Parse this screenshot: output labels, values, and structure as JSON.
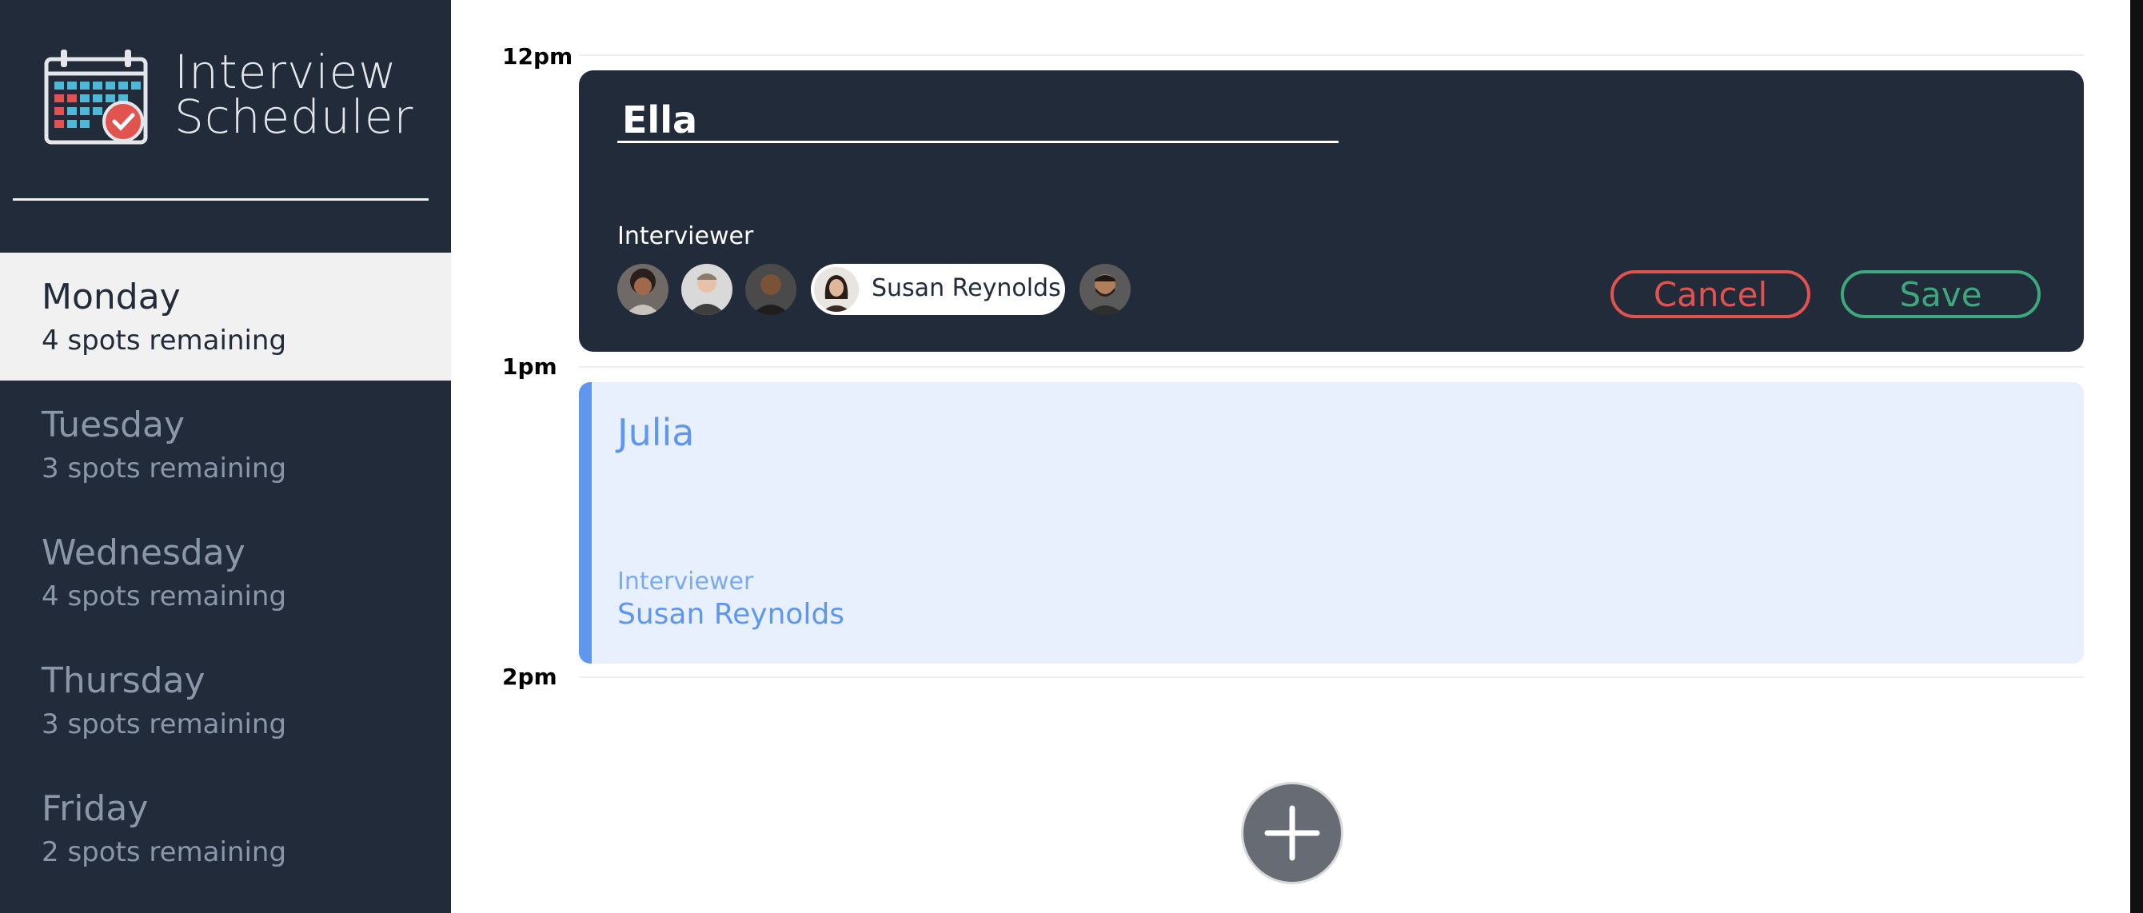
{
  "app": {
    "title_line1": "Interview",
    "title_line2": "Scheduler"
  },
  "days": [
    {
      "name": "Monday",
      "spots": "4 spots remaining",
      "selected": true
    },
    {
      "name": "Tuesday",
      "spots": "3 spots remaining",
      "selected": false
    },
    {
      "name": "Wednesday",
      "spots": "4 spots remaining",
      "selected": false
    },
    {
      "name": "Thursday",
      "spots": "3 spots remaining",
      "selected": false
    },
    {
      "name": "Friday",
      "spots": "2 spots remaining",
      "selected": false
    }
  ],
  "times": [
    "12pm",
    "1pm",
    "2pm"
  ],
  "edit_form": {
    "student_name": "Ella",
    "interviewer_heading": "Interviewer",
    "selected_interviewer": "Susan Reynolds",
    "cancel_label": "Cancel",
    "save_label": "Save"
  },
  "appointment": {
    "student": "Julia",
    "interviewer_label": "Interviewer",
    "interviewer_name": "Susan Reynolds"
  },
  "colors": {
    "sidebar_bg": "#222b3a",
    "cancel": "#e0534e",
    "save": "#3fa77c",
    "appointment_accent": "#5f97ee"
  }
}
